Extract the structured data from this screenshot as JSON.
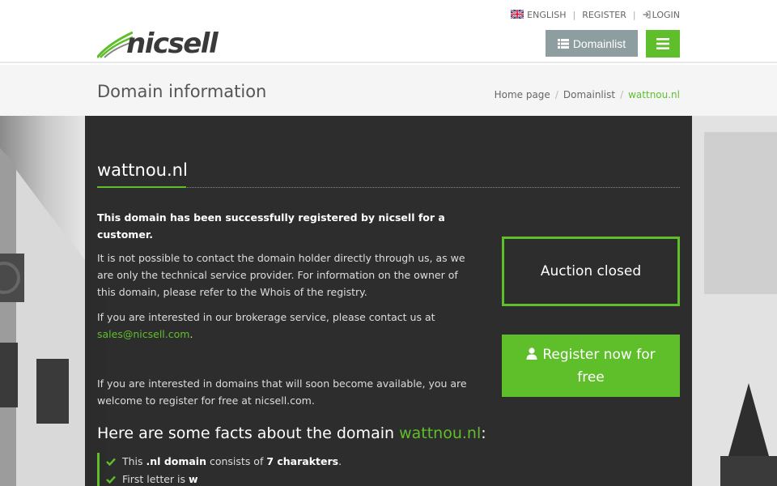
{
  "topnav": {
    "language": "ENGLISH",
    "register": "REGISTER",
    "login": "LOGIN"
  },
  "header": {
    "logo_text": "nicsell",
    "domainlist_button": "Domainlist"
  },
  "titlebar": {
    "title": "Domain information",
    "breadcrumb": [
      "Home page",
      "Domainlist",
      "wattnou.nl"
    ]
  },
  "main": {
    "domain": "wattnou.nl",
    "intro_bold": "This domain has been successfully registered by nicsell for a customer.",
    "para1": "It is not possible to contact the domain holder directly through us, as we are only the technical service provider. For information on the owner of this domain, please refer to the Whois of the registry.",
    "para2_prefix": "If you are interested in our brokerage service, please contact us at ",
    "para2_email": "sales@nicsell.com",
    "para2_suffix": ".",
    "para3": "If you are interested in domains that will soon become available, you are welcome to register for free at nicsell.com.",
    "auction_status": "Auction closed",
    "register_button": "Register now for free",
    "facts_prefix": "Here are some facts about the domain ",
    "facts_domain": "wattnou.nl",
    "facts_suffix": ":",
    "facts": [
      {
        "a": "This ",
        "b": ".nl domain",
        "c": " consists of ",
        "d": "7 charakters",
        "e": "."
      },
      {
        "a": "First letter is ",
        "b": "w",
        "c": "",
        "d": "",
        "e": ""
      }
    ]
  },
  "colors": {
    "accent": "#5fbf2b",
    "domainlist_button": "#8e9ea0",
    "panel": "#1e1e1e"
  },
  "icons": [
    "uk-flag-icon",
    "login-icon",
    "list-icon",
    "hamburger-menu-icon",
    "user-icon",
    "check-icon"
  ]
}
